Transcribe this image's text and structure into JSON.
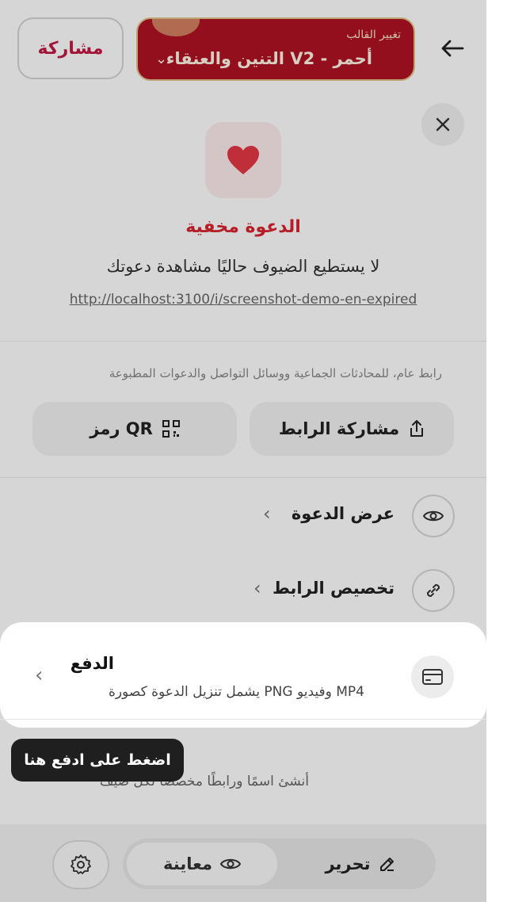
{
  "header": {
    "share_label": "مشاركة",
    "template_small_label": "تغيير القالب",
    "template_name": "التنين والعنقاء V2 - أحمر"
  },
  "sheet": {
    "status_title": "الدعوة مخفية",
    "status_description": "لا يستطيع الضيوف حاليًا مشاهدة دعوتك",
    "invite_url": "http://localhost:3100/i/screenshot-demo-en-expired",
    "share_hint": "رابط عام، للمحادثات الجماعية ووسائل التواصل والدعوات المطبوعة",
    "share_link_label": "مشاركة الرابط",
    "qr_label": "رمز QR",
    "menu": [
      {
        "label": "عرض الدعوة",
        "icon": "eye-icon"
      },
      {
        "label": "تخصيص الرابط",
        "icon": "link-icon"
      }
    ],
    "payment": {
      "title": "الدفع",
      "description": "يشمل تنزيل الدعوة كصورة PNG وفيديو MP4",
      "icon": "credit-card-icon"
    },
    "guest_row": {
      "description": "أنشئ اسمًا ورابطًا مخصصًا لكل ضيف",
      "icon": "users-icon"
    }
  },
  "tooltip": {
    "text": "اضغط على ادفع هنا"
  },
  "bottom_bar": {
    "preview_label": "معاينة",
    "edit_label": "تحرير"
  },
  "colors": {
    "accent_red": "#d9242f",
    "brand_crimson": "#c21a44",
    "template_red": "#b01324",
    "guest_fab": "#e91e63"
  }
}
